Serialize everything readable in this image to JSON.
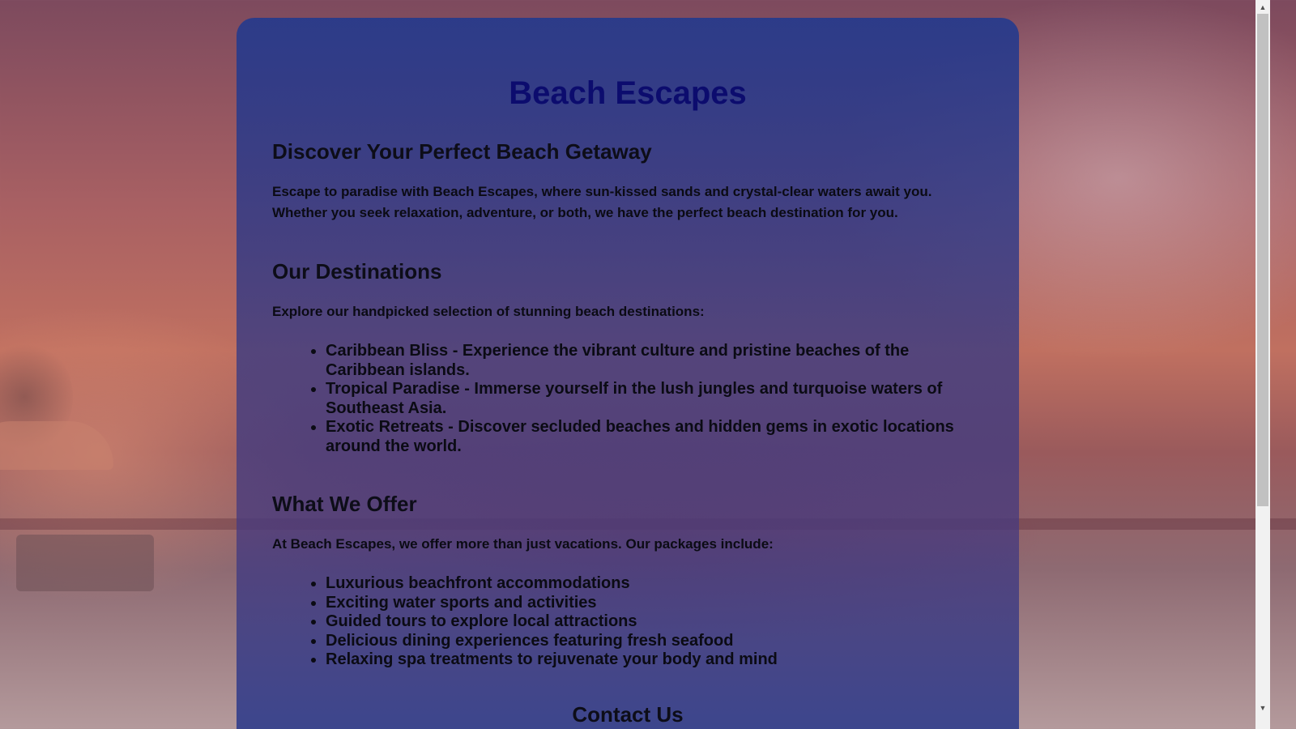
{
  "site": {
    "title": "Beach Escapes"
  },
  "sections": {
    "intro": {
      "heading": "Discover Your Perfect Beach Getaway",
      "text": "Escape to paradise with Beach Escapes, where sun-kissed sands and crystal-clear waters await you. Whether you seek relaxation, adventure, or both, we have the perfect beach destination for you."
    },
    "destinations": {
      "heading": "Our Destinations",
      "text": "Explore our handpicked selection of stunning beach destinations:",
      "items": [
        "Caribbean Bliss - Experience the vibrant culture and pristine beaches of the Caribbean islands.",
        "Tropical Paradise - Immerse yourself in the lush jungles and turquoise waters of Southeast Asia.",
        "Exotic Retreats - Discover secluded beaches and hidden gems in exotic locations around the world."
      ]
    },
    "offer": {
      "heading": "What We Offer",
      "text": "At Beach Escapes, we offer more than just vacations. Our packages include:",
      "items": [
        "Luxurious beachfront accommodations",
        "Exciting water sports and activities",
        "Guided tours to explore local attractions",
        "Delicious dining experiences featuring fresh seafood",
        "Relaxing spa treatments to rejuvenate your body and mind"
      ]
    },
    "contact": {
      "heading": "Contact Us"
    }
  },
  "scrollbar": {
    "up_icon": "scroll-up-arrow-icon",
    "down_icon": "scroll-down-arrow-icon"
  }
}
